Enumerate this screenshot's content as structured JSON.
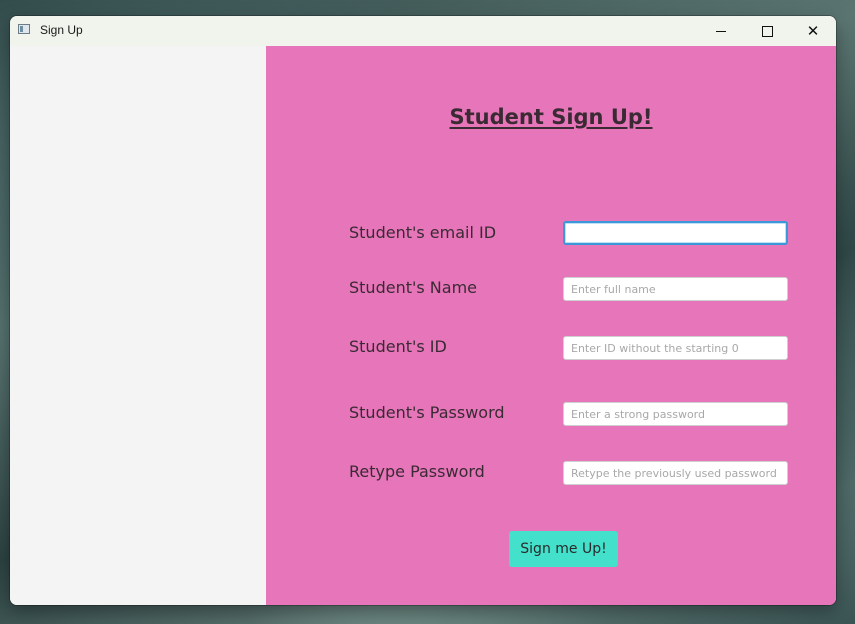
{
  "window": {
    "title": "Sign Up",
    "icon": "app-window-icon",
    "controls": {
      "minimize_icon": "minimize-icon",
      "maximize_icon": "maximize-icon",
      "close_icon": "close-icon"
    }
  },
  "form": {
    "heading": "Student Sign Up!",
    "accent_color": "#e675b9",
    "fields": [
      {
        "label": "Student's email ID",
        "placeholder": "",
        "value": ""
      },
      {
        "label": "Student's Name",
        "placeholder": "Enter full name",
        "value": ""
      },
      {
        "label": "Student's ID",
        "placeholder": "Enter ID without the starting 0",
        "value": ""
      },
      {
        "label": "Student's Password",
        "placeholder": "Enter a strong password",
        "value": ""
      },
      {
        "label": "Retype Password",
        "placeholder": "Retype the previously used password",
        "value": ""
      }
    ],
    "submit_label": "Sign me Up!",
    "submit_color": "#43e0cc"
  }
}
